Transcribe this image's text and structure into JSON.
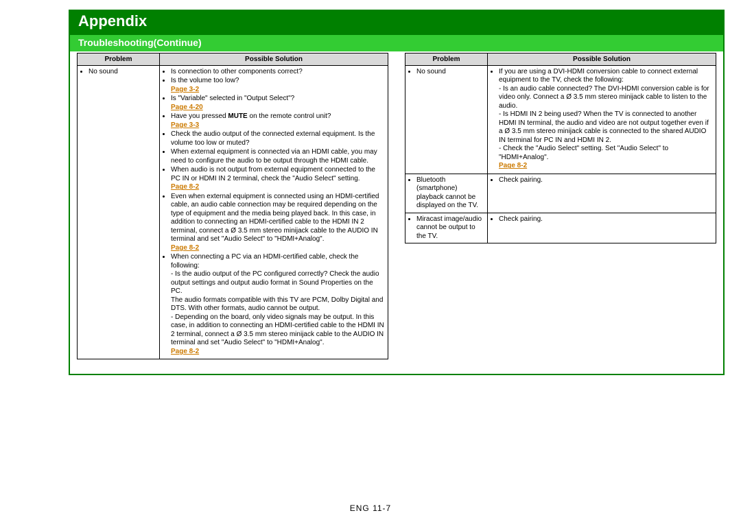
{
  "chapter_title": "Appendix",
  "section_title": "Troubleshooting(Continue)",
  "headers": {
    "problem": "Problem",
    "solution": "Possible Solution"
  },
  "page_refs": {
    "p3_2": "Page 3-2",
    "p4_20": "Page 4-20",
    "p3_3": "Page 3-3",
    "p8_2": "Page 8-2"
  },
  "left": {
    "rows": [
      {
        "problem": "No sound",
        "solutions": {
          "s1": "Is connection to other components correct?",
          "s2": "Is the volume too low?",
          "s3": "Is \"Variable\" selected in \"Output Select\"?",
          "s4a": "Have you pressed ",
          "s4b": "MUTE",
          "s4c": " on the remote control unit?",
          "s5": "Check the audio output of the connected external equipment. Is the volume too low or muted?",
          "s6": "When external equipment is connected via an HDMI cable, you may need to configure the audio to be output through the HDMI cable.",
          "s7": "When audio is not output from external equipment connected to the PC IN or HDMI IN 2 terminal, check the \"Audio Select\" setting.",
          "s8": "Even when external equipment is connected using an HDMI-certified cable, an audio cable connection may be required depending on the type of equipment and the media being played back. In this case, in addition to connecting an HDMI-certified cable to the HDMI IN 2 terminal, connect a Ø 3.5 mm stereo minijack cable to the AUDIO IN terminal and set \"Audio Select\" to \"HDMI+Analog\".",
          "s9": "When connecting a PC via an HDMI-certified cable, check the following:",
          "s9a": "- Is the audio output of the PC configured correctly? Check the audio output settings and output audio format in Sound Properties on the PC.",
          "s9b": "The audio formats compatible with this TV are PCM, Dolby Digital and DTS. With other formats, audio cannot be output.",
          "s9c": "- Depending on the board, only video signals may be output. In this case, in addition to connecting an HDMI-certified cable to the HDMI IN 2 terminal, connect a Ø 3.5 mm stereo minijack cable to the AUDIO IN terminal and set \"Audio Select\" to \"HDMI+Analog\"."
        }
      }
    ]
  },
  "right": {
    "rows": [
      {
        "problem": "No sound",
        "solutions": {
          "s1": "If you are using a DVI-HDMI conversion cable to connect external equipment to the TV, check the following:",
          "s1a": "- Is an audio cable connected? The DVI-HDMI conversion cable is for video only. Connect a Ø 3.5 mm stereo minijack cable to listen to the audio.",
          "s1b": "- Is HDMI IN 2 being used? When the TV is connected to another HDMI IN terminal, the audio and video are not output together even if a Ø 3.5 mm stereo minijack cable is connected to the shared AUDIO IN terminal for PC IN and HDMI IN 2.",
          "s1c": "- Check the \"Audio Select\" setting. Set \"Audio Select\" to \"HDMI+Analog\"."
        }
      },
      {
        "problem": "Bluetooth (smartphone) playback cannot be displayed on the TV.",
        "solutions": {
          "s1": "Check pairing."
        }
      },
      {
        "problem": "Miracast image/audio cannot be output to the TV.",
        "solutions": {
          "s1": "Check pairing."
        }
      }
    ]
  },
  "footer": "ENG 11-7"
}
